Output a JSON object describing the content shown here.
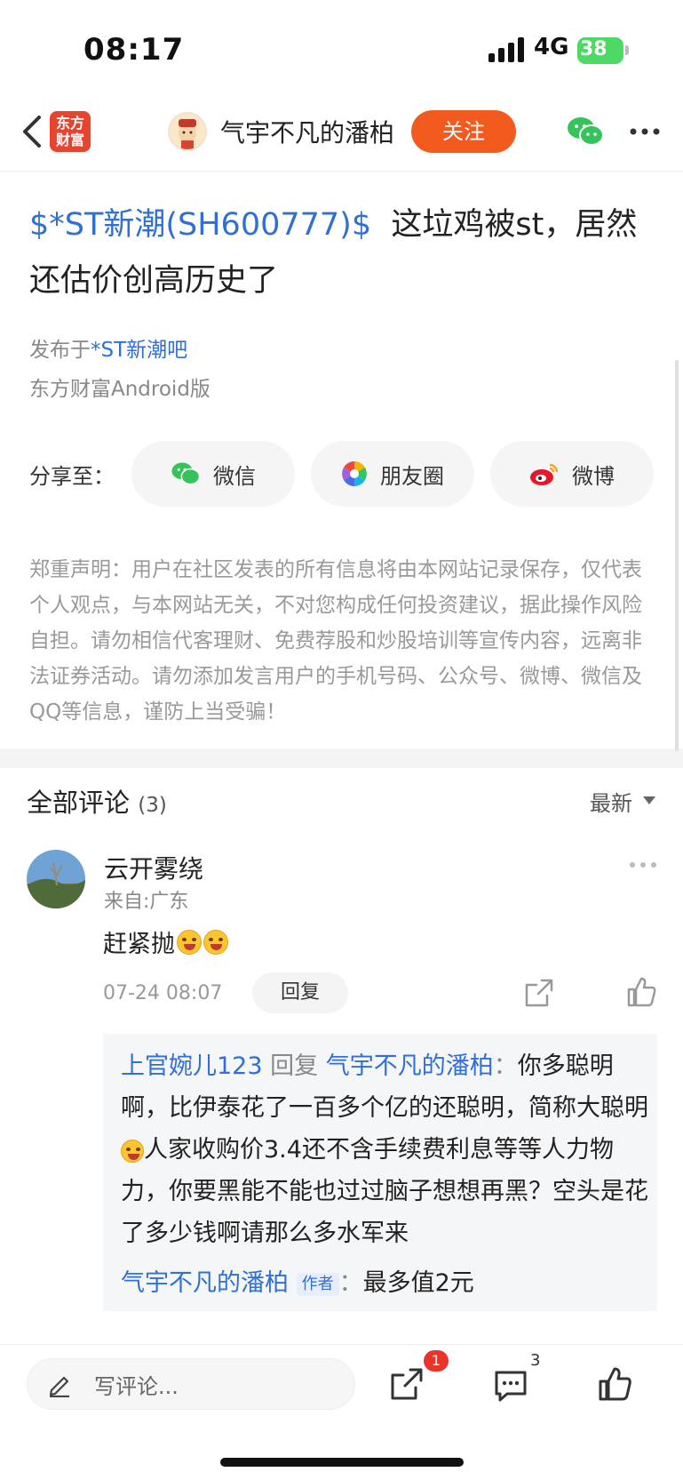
{
  "status_bar": {
    "time": "08:17",
    "network": "4G",
    "battery": "38"
  },
  "nav": {
    "brand_line1": "东方",
    "brand_line2": "财富",
    "author_name": "气宇不凡的潘柏",
    "follow_label": "关注"
  },
  "post": {
    "stock_tag": "$*ST新潮(SH600777)$",
    "title_text": "这垃鸡被st，居然还估价创高历史了",
    "published_prefix": "发布于",
    "forum": "*ST新潮吧",
    "platform": "东方财富Android版"
  },
  "share": {
    "label": "分享至：",
    "targets": [
      {
        "label": "微信",
        "icon": "wechat-icon"
      },
      {
        "label": "朋友圈",
        "icon": "moments-icon"
      },
      {
        "label": "微博",
        "icon": "weibo-icon"
      }
    ]
  },
  "disclaimer": "郑重声明：用户在社区发表的所有信息将由本网站记录保存，仅代表个人观点，与本网站无关，不对您构成任何投资建议，据此操作风险自担。请勿相信代客理财、免费荐股和炒股培训等宣传内容，远离非法证券活动。请勿添加发言用户的手机号码、公众号、微博、微信及QQ等信息，谨防上当受骗！",
  "comments_header": {
    "label": "全部评论",
    "count": "(3)",
    "sort": "最新"
  },
  "comment": {
    "user": "云开雾绕",
    "from": "来自:广东",
    "text": "赶紧抛",
    "time": "07-24 08:07",
    "reply_label": "回复",
    "replies": [
      {
        "user": "上官婉儿123",
        "verb": " 回复 ",
        "target": "气宇不凡的潘柏",
        "sep": "：",
        "text_before_emoji": "你多聪明啊，比伊泰花了一百多个亿的还聪明，简称大聪明",
        "text_after_emoji": "人家收购价3.4还不含手续费利息等等人力物力，你要黑能不能也过过脑子想想再黑？空头是花了多少钱啊请那么多水军来"
      },
      {
        "user": "气宇不凡的潘柏",
        "tag": "作者",
        "sep": "：",
        "text": "最多值2元"
      }
    ]
  },
  "bottom_bar": {
    "placeholder": "写评论...",
    "share_badge": "1",
    "comment_count": "3"
  },
  "colors": {
    "accent_blue": "#2f6fd6",
    "follow_orange": "#f25a1e",
    "brand_red": "#e8432e",
    "badge_red": "#e8342b"
  }
}
